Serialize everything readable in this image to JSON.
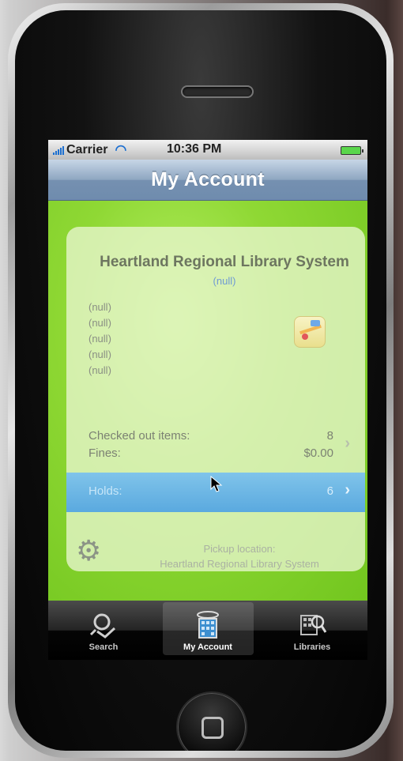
{
  "status_bar": {
    "carrier": "Carrier",
    "time": "10:36 PM"
  },
  "nav": {
    "title": "My Account"
  },
  "account": {
    "library_name": "Heartland Regional Library System",
    "library_subtitle": "(null)",
    "address_lines": [
      "(null)",
      "(null)",
      "(null)",
      "(null)",
      "(null)"
    ],
    "checked_out_label": "Checked out items:",
    "checked_out_value": "8",
    "fines_label": "Fines:",
    "fines_value": "$0.00",
    "holds_label": "Holds:",
    "holds_value": "6",
    "pickup_label": "Pickup location:",
    "pickup_value": "Heartland Regional Library System"
  },
  "tabs": [
    {
      "label": "Search",
      "icon": "search-icon",
      "active": false
    },
    {
      "label": "My Account",
      "icon": "my-account-icon",
      "active": true
    },
    {
      "label": "Libraries",
      "icon": "libraries-icon",
      "active": false
    }
  ],
  "colors": {
    "nav_bar": "#7590b0",
    "content_green": "#8fd834",
    "holds_highlight": "#5aa9df"
  }
}
